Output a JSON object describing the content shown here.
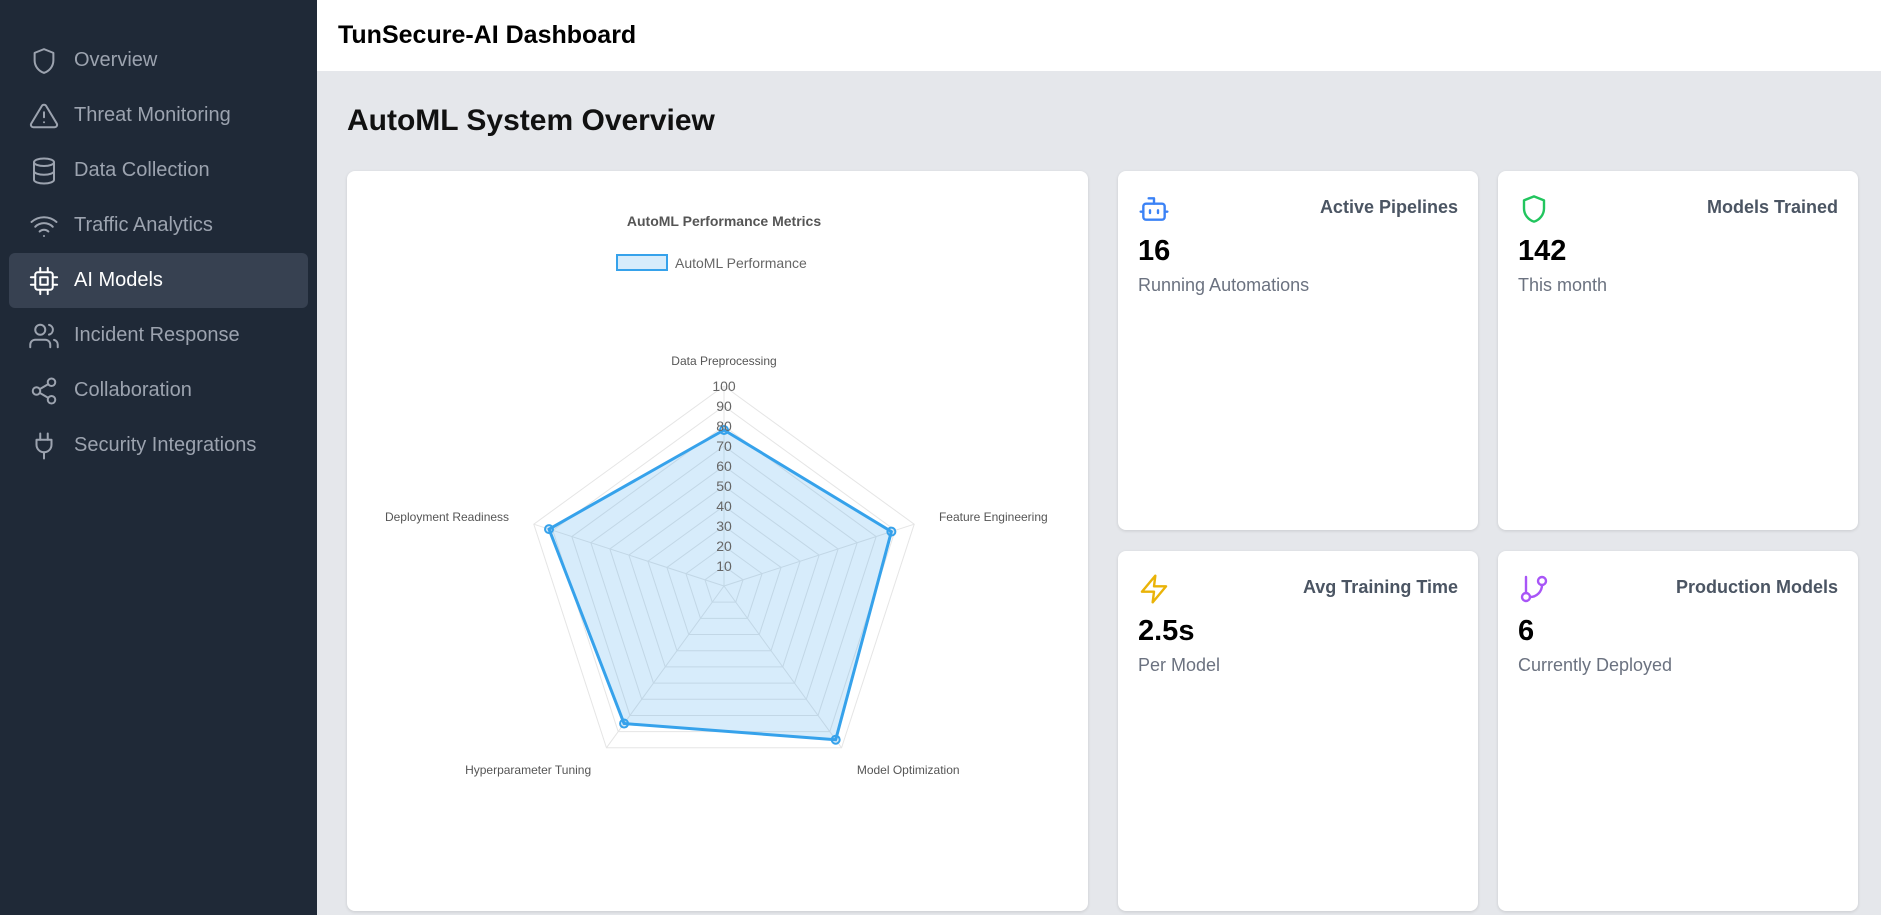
{
  "app": {
    "title": "TunSecure-AI Dashboard"
  },
  "sidebar": {
    "items": [
      {
        "label": "Overview",
        "icon": "shield-icon",
        "active": false
      },
      {
        "label": "Threat Monitoring",
        "icon": "alert-triangle-icon",
        "active": false
      },
      {
        "label": "Data Collection",
        "icon": "database-icon",
        "active": false
      },
      {
        "label": "Traffic Analytics",
        "icon": "wifi-icon",
        "active": false
      },
      {
        "label": "AI Models",
        "icon": "cpu-icon",
        "active": true
      },
      {
        "label": "Incident Response",
        "icon": "users-icon",
        "active": false
      },
      {
        "label": "Collaboration",
        "icon": "share-icon",
        "active": false
      },
      {
        "label": "Security Integrations",
        "icon": "plug-icon",
        "active": false
      }
    ]
  },
  "main": {
    "title": "AutoML System Overview",
    "stats": [
      {
        "title": "Active Pipelines",
        "value": "16",
        "subtitle": "Running Automations",
        "icon": "bot-icon",
        "color": "#3b82f6"
      },
      {
        "title": "Models Trained",
        "value": "142",
        "subtitle": "This month",
        "icon": "shield-icon",
        "color": "#22c55e"
      },
      {
        "title": "Avg Training Time",
        "value": "2.5s",
        "subtitle": "Per Model",
        "icon": "zap-icon",
        "color": "#eab308"
      },
      {
        "title": "Production Models",
        "value": "6",
        "subtitle": "Currently Deployed",
        "icon": "git-branch-icon",
        "color": "#a855f7"
      }
    ]
  },
  "chart_data": {
    "type": "radar",
    "title": "AutoML Performance Metrics",
    "categories": [
      "Data Preprocessing",
      "Feature Engineering",
      "Model Optimization",
      "Hyperparameter Tuning",
      "Deployment Readiness"
    ],
    "series": [
      {
        "name": "AutoML Performance",
        "values": [
          78,
          88,
          95,
          85,
          92
        ],
        "color": "#36a2eb"
      }
    ],
    "rlim": [
      0,
      100
    ],
    "ticks": [
      "10",
      "20",
      "30",
      "40",
      "50",
      "60",
      "70",
      "80",
      "90",
      "100"
    ],
    "legend": "top"
  }
}
